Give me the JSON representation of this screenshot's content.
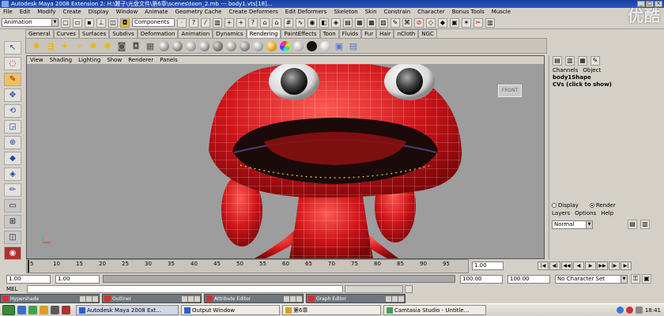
{
  "window": {
    "title": "Autodesk Maya 2008 Extension 2: H:\\鞭子\\光盘文件\\第6章\\scenes\\toon_2.mb  ---  body1.vts[18]...",
    "controls": [
      "_",
      "□",
      "×"
    ]
  },
  "watermark": "优酷",
  "menubar": [
    "File",
    "Edit",
    "Modify",
    "Create",
    "Display",
    "Window",
    "Animate",
    "Geometry Cache",
    "Create Deformers",
    "Edit Deformers",
    "Skeleton",
    "Skin",
    "Constrain",
    "Character",
    "Bonus Tools",
    "Muscle"
  ],
  "statusline": {
    "menuset": "Animation",
    "selection_mode": "Components"
  },
  "shelf_tabs": [
    {
      "label": "General",
      "active": false
    },
    {
      "label": "Curves",
      "active": false
    },
    {
      "label": "Surfaces",
      "active": false
    },
    {
      "label": "Subdivs",
      "active": false
    },
    {
      "label": "Deformation",
      "active": false
    },
    {
      "label": "Animation",
      "active": false
    },
    {
      "label": "Dynamics",
      "active": false
    },
    {
      "label": "Rendering",
      "active": true
    },
    {
      "label": "PaintEffects",
      "active": false
    },
    {
      "label": "Toon",
      "active": false
    },
    {
      "label": "Fluids",
      "active": false
    },
    {
      "label": "Fur",
      "active": false
    },
    {
      "label": "Hair",
      "active": false
    },
    {
      "label": "nCloth",
      "active": false
    },
    {
      "label": "NGC",
      "active": false
    }
  ],
  "viewport": {
    "menus": [
      "View",
      "Shading",
      "Lighting",
      "Show",
      "Renderer",
      "Panels"
    ],
    "view_cube": "FRONT",
    "colors": {
      "character_red": "#d0151a",
      "wire": "#e8e8e8",
      "background": "#9d9d9d"
    }
  },
  "channel_box": {
    "menus": [
      "Channels",
      "Object"
    ],
    "object_name": "body1Shape",
    "cvs_label": "CVs (click to show)"
  },
  "layer_editor": {
    "display_label": "Display",
    "render_label": "Render",
    "selected_tab": "Render",
    "menus": [
      "Layers",
      "Options",
      "Help"
    ],
    "blend_mode": "Normal"
  },
  "time_slider": {
    "ticks": [
      "5",
      "10",
      "15",
      "20",
      "25",
      "30",
      "35",
      "40",
      "45",
      "50",
      "55",
      "60",
      "65",
      "70",
      "75",
      "80",
      "85",
      "90",
      "95"
    ],
    "current_frame": "1.00"
  },
  "range_slider": {
    "start": "1.00",
    "inner_start": "1.00",
    "inner_end": "100.00",
    "end": "100.00",
    "character_set": "No Character Set"
  },
  "command_line": {
    "label": "MEL"
  },
  "mdi_windows": [
    {
      "label": "Hypershade"
    },
    {
      "label": "Outliner"
    },
    {
      "label": "Attribute Editor"
    },
    {
      "label": "Graph Editor"
    }
  ],
  "taskbar": {
    "tasks": [
      "Autodesk Maya 2008 Ext...",
      "Output Window",
      "第6章",
      "Camtasia Studio - Untitle..."
    ],
    "clock": "18:41"
  }
}
